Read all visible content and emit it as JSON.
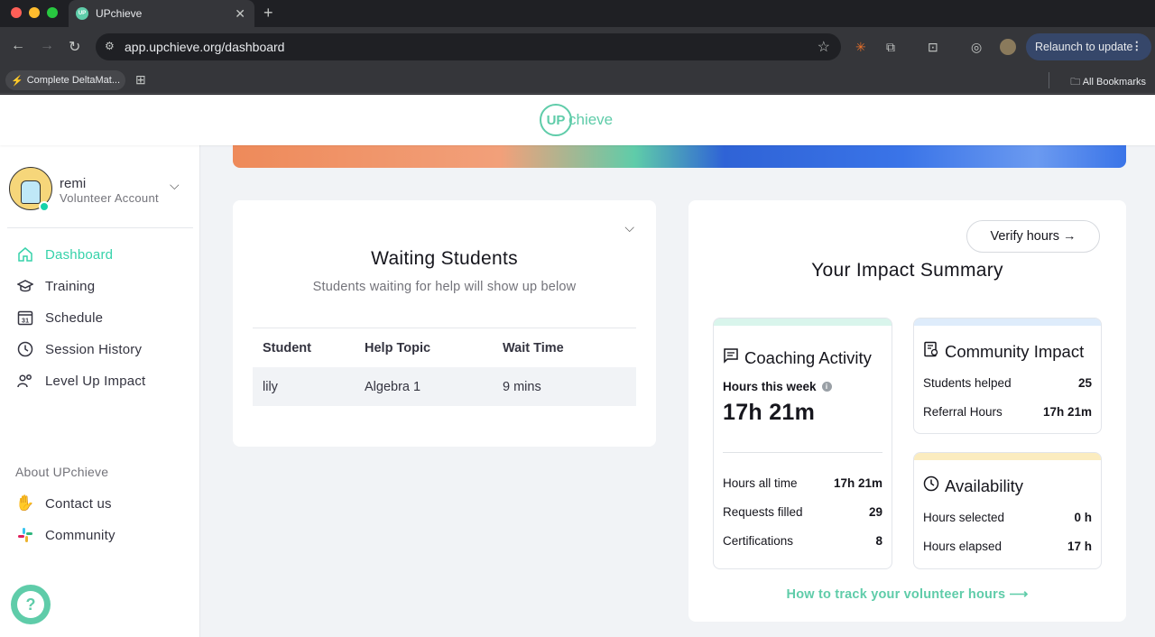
{
  "browser": {
    "tab_title": "UPchieve",
    "favicon_text": "UP",
    "url": "app.upchieve.org/dashboard",
    "relaunch_label": "Relaunch to update",
    "bookmark_label": "Complete DeltaMat...",
    "all_bookmarks_label": "All Bookmarks"
  },
  "header": {
    "logo_up": "UP",
    "logo_word": "chieve"
  },
  "user": {
    "name": "remi",
    "account_type": "Volunteer Account"
  },
  "nav": {
    "items": [
      {
        "label": "Dashboard",
        "icon": "home-icon"
      },
      {
        "label": "Training",
        "icon": "graduation-cap-icon"
      },
      {
        "label": "Schedule",
        "icon": "calendar-icon"
      },
      {
        "label": "Session History",
        "icon": "clock-icon"
      },
      {
        "label": "Level Up Impact",
        "icon": "people-icon"
      }
    ],
    "about_label": "About UPchieve",
    "contact_label": "Contact us",
    "community_label": "Community"
  },
  "waiting": {
    "title": "Waiting Students",
    "subtitle": "Students waiting for help will show up below",
    "headers": [
      "Student",
      "Help Topic",
      "Wait Time"
    ],
    "rows": [
      {
        "student": "lily",
        "topic": "Algebra 1",
        "wait": "9 mins"
      }
    ]
  },
  "impact": {
    "verify_label": "Verify hours →",
    "title": "Your Impact Summary",
    "coaching": {
      "title": "Coaching Activity",
      "hours_week_label": "Hours this week",
      "hours_week_value": "17h 21m",
      "rows": [
        {
          "label": "Hours all time",
          "value": "17h 21m"
        },
        {
          "label": "Requests filled",
          "value": "29"
        },
        {
          "label": "Certifications",
          "value": "8"
        }
      ]
    },
    "community": {
      "title": "Community Impact",
      "rows": [
        {
          "label": "Students helped",
          "value": "25"
        },
        {
          "label": "Referral Hours",
          "value": "17h 21m"
        }
      ]
    },
    "availability": {
      "title": "Availability",
      "rows": [
        {
          "label": "Hours selected",
          "value": "0 h"
        },
        {
          "label": "Hours elapsed",
          "value": "17 h"
        }
      ]
    },
    "track_link": "How to track your volunteer hours ⟶"
  },
  "colors": {
    "brand": "#5fcca9",
    "active_nav": "#36d2aa",
    "coaching_bar": "#d9f5ec",
    "community_bar": "#deecfb",
    "availability_bar": "#fbecbf"
  }
}
